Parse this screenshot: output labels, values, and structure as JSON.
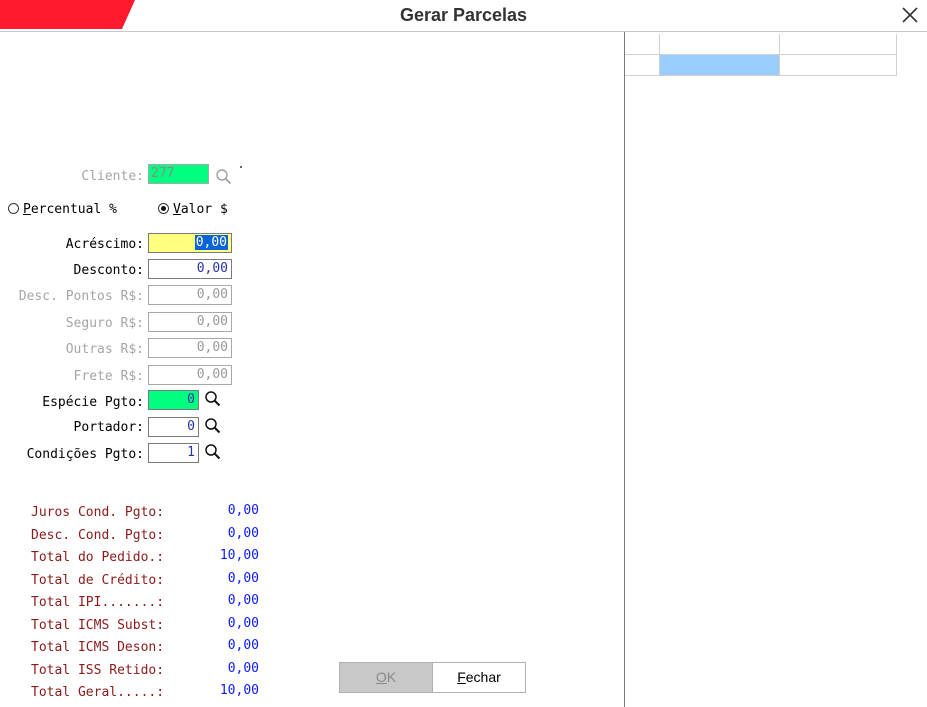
{
  "window": {
    "title": "Gerar Parcelas",
    "accent_color": "#ff1a2e"
  },
  "cliente": {
    "label": "Cliente:",
    "value": "277"
  },
  "mode": {
    "percentual": {
      "underline": "P",
      "rest": "ercentual %",
      "selected": false
    },
    "valor": {
      "underline": "V",
      "rest": "alor $",
      "selected": true
    }
  },
  "fields": {
    "acrescimo": {
      "label": "Acréscimo:",
      "value": "0,00"
    },
    "desconto": {
      "label": "Desconto:",
      "value": "0,00"
    },
    "desc_pontos": {
      "label": "Desc. Pontos R$:",
      "value": "0,00"
    },
    "seguro": {
      "label": "Seguro R$:",
      "value": "0,00"
    },
    "outras": {
      "label": "Outras R$:",
      "value": "0,00"
    },
    "frete": {
      "label": "Frete R$:",
      "value": "0,00"
    },
    "especie": {
      "label": "Espécie Pgto:",
      "value": "0"
    },
    "portador": {
      "label": "Portador:",
      "value": "0"
    },
    "condicoes": {
      "label": "Condições Pgto:",
      "value": "1"
    }
  },
  "summary": [
    {
      "label": "Juros Cond. Pgto:",
      "value": "0,00"
    },
    {
      "label": "Desc. Cond. Pgto:",
      "value": "0,00"
    },
    {
      "label": "Total do Pedido.:",
      "value": "10,00"
    },
    {
      "label": "Total de Crédito:",
      "value": "0,00"
    },
    {
      "label": "Total IPI.......:",
      "value": "0,00"
    },
    {
      "label": "Total ICMS Subst:",
      "value": "0,00"
    },
    {
      "label": "Total ICMS Deson:",
      "value": "0,00"
    },
    {
      "label": "Total ISS Retido:",
      "value": "0,00"
    },
    {
      "label": "Total Geral.....:",
      "value": "10,00"
    }
  ],
  "buttons": {
    "ok": {
      "underline": "O",
      "rest": "K",
      "enabled": false
    },
    "fechar": {
      "underline": "F",
      "rest": "echar",
      "enabled": true
    }
  },
  "grid": {
    "selected_cell_color": "#99ccff"
  },
  "icons": [
    "close-icon",
    "search-icon"
  ]
}
